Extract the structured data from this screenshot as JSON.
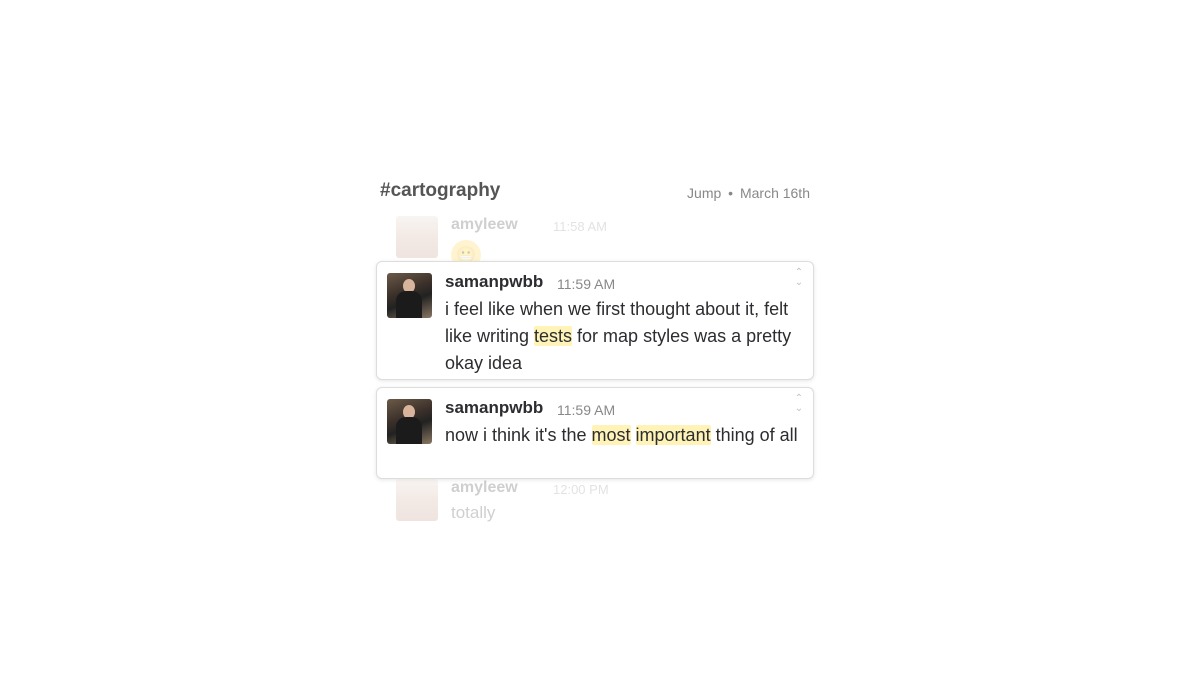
{
  "header": {
    "channel": "#cartography",
    "jump_label": "Jump",
    "separator": "•",
    "date": "March 16th"
  },
  "messages": [
    {
      "user": "amyleew",
      "time": "11:58 AM",
      "body": "😬",
      "faded": true
    },
    {
      "user": "samanpwbb",
      "time": "11:59 AM",
      "parts": [
        "i feel like when we first thought about it, felt like writing ",
        "tests",
        " for map styles was a pretty okay idea"
      ],
      "highlights": [
        1
      ],
      "faded": false
    },
    {
      "user": "samanpwbb",
      "time": "11:59 AM",
      "parts": [
        "now i think it's the ",
        "most",
        " ",
        "important",
        " thing of all"
      ],
      "highlights": [
        1,
        3
      ],
      "faded": false
    },
    {
      "user": "amyleew",
      "time": "12:00 PM",
      "body": "totally",
      "faded": true
    }
  ],
  "icons": {
    "expand_up": "chevron-up-icon",
    "expand_down": "chevron-down-icon"
  },
  "colors": {
    "highlight": "#fff3b8",
    "text": "#2c2d30",
    "muted": "#888888"
  }
}
